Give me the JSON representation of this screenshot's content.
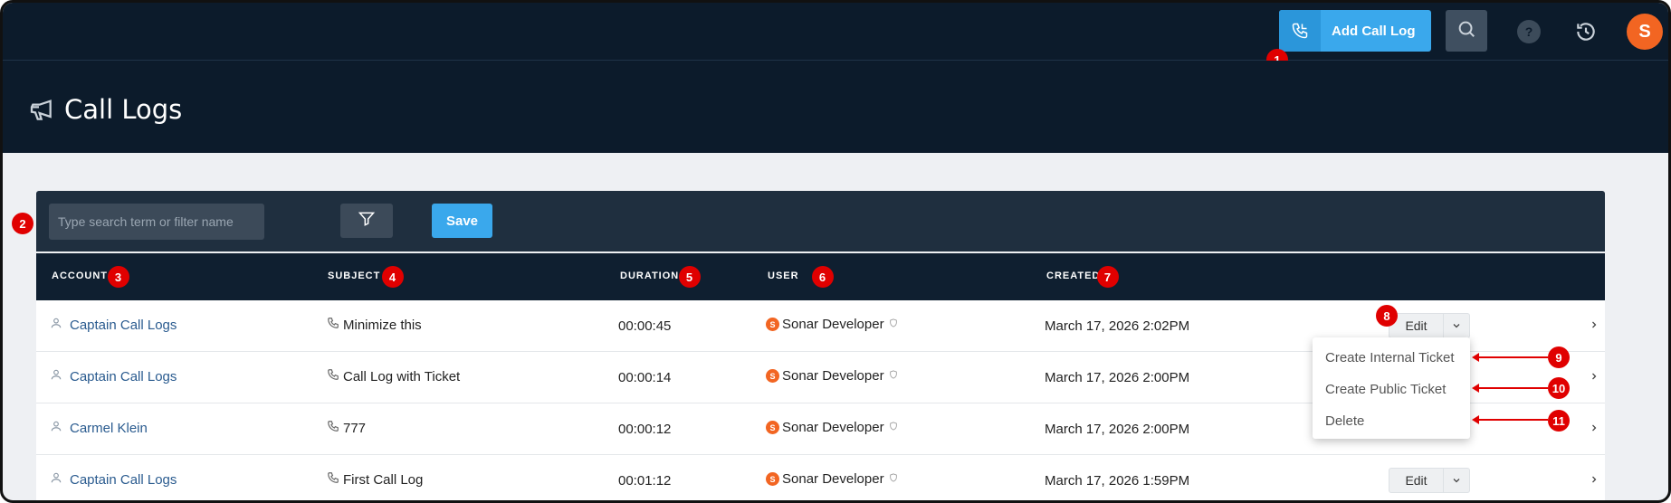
{
  "topbar": {
    "add_call_log_label": "Add Call Log",
    "help_label": "?",
    "avatar_initial": "S"
  },
  "header": {
    "title": "Call Logs"
  },
  "filter": {
    "search_placeholder": "Type search term or filter name",
    "save_label": "Save"
  },
  "table": {
    "columns": [
      "ACCOUNT",
      "SUBJECT",
      "DURATION",
      "USER",
      "CREATED"
    ],
    "rows": [
      {
        "account": "Captain Call Logs",
        "subject": "Minimize this",
        "duration": "00:00:45",
        "user": "Sonar Developer",
        "created": "March 17, 2026 2:02PM"
      },
      {
        "account": "Captain Call Logs",
        "subject": "Call Log with Ticket",
        "duration": "00:00:14",
        "user": "Sonar Developer",
        "created": "March 17, 2026 2:00PM"
      },
      {
        "account": "Carmel Klein",
        "subject": "777",
        "duration": "00:00:12",
        "user": "Sonar Developer",
        "created": "March 17, 2026 2:00PM"
      },
      {
        "account": "Captain Call Logs",
        "subject": "First Call Log",
        "duration": "00:01:12",
        "user": "Sonar Developer",
        "created": "March 17, 2026 1:59PM"
      }
    ],
    "edit_label": "Edit",
    "user_badge": "S"
  },
  "dropdown": {
    "items": [
      "Create Internal Ticket",
      "Create Public Ticket",
      "Delete"
    ]
  },
  "markers": [
    "1",
    "2",
    "3",
    "4",
    "5",
    "6",
    "7",
    "8",
    "9",
    "10",
    "11"
  ],
  "colors": {
    "navy": "#0c1b2b",
    "accent": "#3aa8ec",
    "brand_orange": "#f26522",
    "marker_red": "#e00000",
    "link": "#2a5b8f"
  }
}
